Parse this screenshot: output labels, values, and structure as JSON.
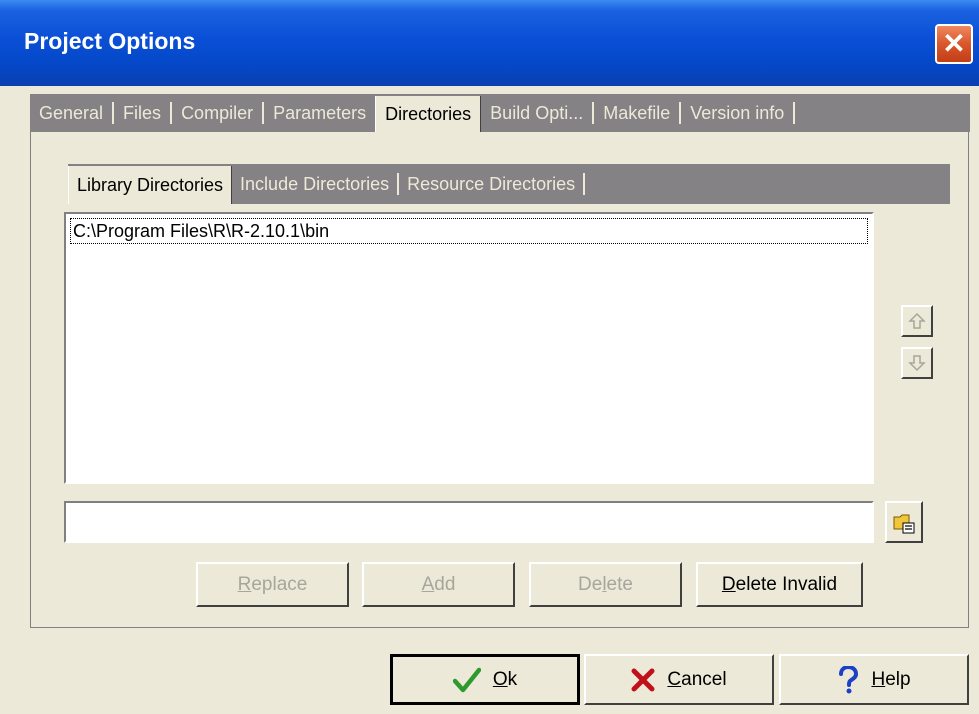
{
  "window": {
    "title": "Project Options",
    "close_glyph": "✕"
  },
  "tabs": [
    {
      "label": "General"
    },
    {
      "label": "Files"
    },
    {
      "label": "Compiler"
    },
    {
      "label": "Parameters"
    },
    {
      "label": "Directories",
      "active": true
    },
    {
      "label": "Build Opti..."
    },
    {
      "label": "Makefile"
    },
    {
      "label": "Version info"
    }
  ],
  "subtabs": [
    {
      "label": "Library Directories",
      "active": true
    },
    {
      "label": "Include Directories"
    },
    {
      "label": "Resource Directories"
    }
  ],
  "directory_list": {
    "items": [
      "C:\\Program Files\\R\\R-2.10.1\\bin"
    ]
  },
  "path_input": {
    "value": "",
    "placeholder": ""
  },
  "buttons": {
    "replace": {
      "first": "R",
      "rest": "eplace"
    },
    "add": {
      "first": "A",
      "rest": "dd"
    },
    "delete": {
      "pre": "De",
      "mid": "l",
      "post": "ete"
    },
    "delete_invalid": {
      "first": "D",
      "rest": "elete Invalid"
    },
    "ok": {
      "first": "O",
      "rest": "k"
    },
    "cancel": {
      "first": "C",
      "rest": "ancel"
    },
    "help": {
      "first": "H",
      "rest": "elp"
    }
  },
  "colors": {
    "title_bar": "#0A4FD6",
    "face": "#ECE9D8",
    "tab_strip": "#848284",
    "ok_icon": "#2E9A2E",
    "cancel_icon": "#C0101A",
    "help_icon": "#1E3FC8",
    "close_button": "#D9572B"
  }
}
